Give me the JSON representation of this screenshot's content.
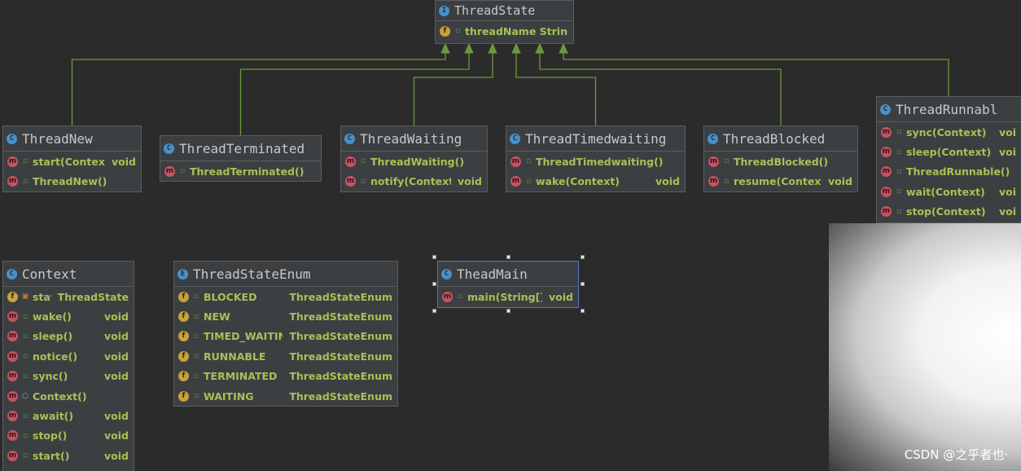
{
  "classes": {
    "threadState": {
      "title": "ThreadState",
      "icon": "interface-icon",
      "rows": [
        {
          "kind": "f",
          "name": "threadName String",
          "type": ""
        }
      ]
    },
    "threadNew": {
      "title": "ThreadNew",
      "icon": "class-icon",
      "rows": [
        {
          "kind": "m",
          "name": "start(Context)",
          "type": "void"
        },
        {
          "kind": "m",
          "name": "ThreadNew()",
          "type": ""
        }
      ]
    },
    "threadTerminated": {
      "title": "ThreadTerminated",
      "icon": "class-icon",
      "rows": [
        {
          "kind": "m",
          "name": "ThreadTerminated()",
          "type": ""
        }
      ]
    },
    "threadWaiting": {
      "title": "ThreadWaiting",
      "icon": "class-icon",
      "rows": [
        {
          "kind": "m",
          "name": "ThreadWaiting()",
          "type": ""
        },
        {
          "kind": "m",
          "name": "notify(Context)",
          "type": "void"
        }
      ]
    },
    "threadTimedwaiting": {
      "title": "ThreadTimedwaiting",
      "icon": "class-icon",
      "rows": [
        {
          "kind": "m",
          "name": "ThreadTimedwaiting()",
          "type": ""
        },
        {
          "kind": "m",
          "name": "wake(Context)",
          "type": "void"
        }
      ]
    },
    "threadBlocked": {
      "title": "ThreadBlocked",
      "icon": "class-icon",
      "rows": [
        {
          "kind": "m",
          "name": "ThreadBlocked()",
          "type": ""
        },
        {
          "kind": "m",
          "name": "resume(Context)",
          "type": "void"
        }
      ]
    },
    "threadRunnable": {
      "title": "ThreadRunnabl",
      "icon": "class-icon",
      "rows": [
        {
          "kind": "m",
          "name": "sync(Context)",
          "type": "voi"
        },
        {
          "kind": "m",
          "name": "sleep(Context)",
          "type": "voi"
        },
        {
          "kind": "m",
          "name": "ThreadRunnable()",
          "type": ""
        },
        {
          "kind": "m",
          "name": "wait(Context)",
          "type": "voi"
        },
        {
          "kind": "m",
          "name": "stop(Context)",
          "type": "voi"
        }
      ]
    },
    "context": {
      "title": "Context",
      "icon": "class-icon",
      "rows": [
        {
          "kind": "f",
          "access": "private",
          "name": "state",
          "type": "ThreadState"
        },
        {
          "kind": "m",
          "name": "wake()",
          "type": "void"
        },
        {
          "kind": "m",
          "name": "sleep()",
          "type": "void"
        },
        {
          "kind": "m",
          "name": "notice()",
          "type": "void"
        },
        {
          "kind": "m",
          "name": "sync()",
          "type": "void"
        },
        {
          "kind": "m",
          "access": "package",
          "name": "Context()",
          "type": ""
        },
        {
          "kind": "m",
          "name": "await()",
          "type": "void"
        },
        {
          "kind": "m",
          "name": "stop()",
          "type": "void"
        },
        {
          "kind": "m",
          "name": "start()",
          "type": "void"
        }
      ]
    },
    "threadStateEnum": {
      "title": "ThreadStateEnum",
      "icon": "enum-icon",
      "rows": [
        {
          "kind": "f",
          "name": "BLOCKED",
          "type": "ThreadStateEnum"
        },
        {
          "kind": "f",
          "name": "NEW",
          "type": "ThreadStateEnum"
        },
        {
          "kind": "f",
          "name": "TIMED_WAITING",
          "type": "ThreadStateEnum"
        },
        {
          "kind": "f",
          "name": "RUNNABLE",
          "type": "ThreadStateEnum"
        },
        {
          "kind": "f",
          "name": "TERMINATED",
          "type": "ThreadStateEnum"
        },
        {
          "kind": "f",
          "name": "WAITING",
          "type": "ThreadStateEnum"
        }
      ]
    },
    "theadMain": {
      "title": "TheadMain",
      "icon": "class-icon",
      "rows": [
        {
          "kind": "m",
          "name": "main(String[])",
          "type": "void"
        }
      ]
    }
  },
  "edges": [
    {
      "from": "threadNew",
      "to": "threadState",
      "type": "implements"
    },
    {
      "from": "threadTerminated",
      "to": "threadState",
      "type": "implements"
    },
    {
      "from": "threadWaiting",
      "to": "threadState",
      "type": "implements"
    },
    {
      "from": "threadTimedwaiting",
      "to": "threadState",
      "type": "implements"
    },
    {
      "from": "threadBlocked",
      "to": "threadState",
      "type": "implements"
    },
    {
      "from": "threadRunnable",
      "to": "threadState",
      "type": "implements"
    }
  ],
  "colors": {
    "edge": "#6a9a3a",
    "member": "#a4c356",
    "header_text": "#c8c8c8"
  },
  "watermark": "CSDN @之乎者也·"
}
